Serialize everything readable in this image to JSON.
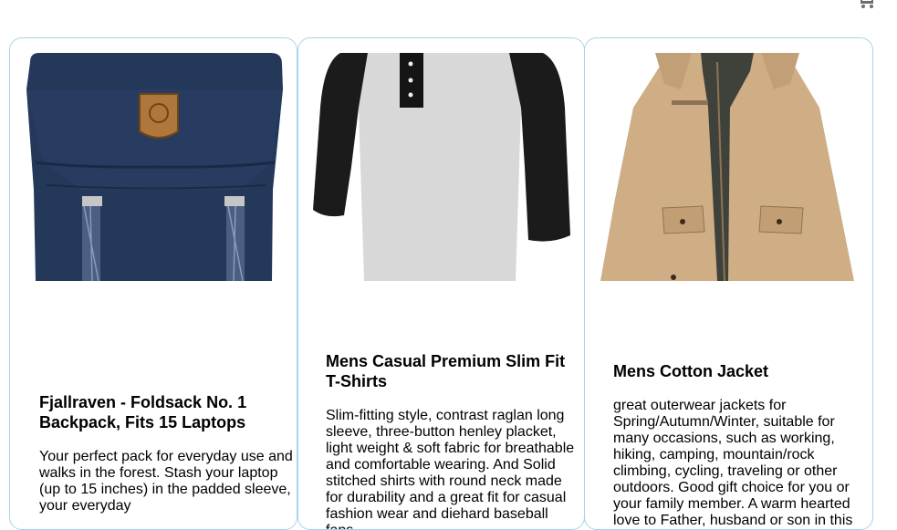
{
  "header": {
    "cart_icon": "shopping-cart-icon"
  },
  "products": [
    {
      "title": "Fjallraven - Foldsack No. 1 Backpack, Fits 15 Laptops",
      "description": "Your perfect pack for everyday use and walks in the forest. Stash your laptop (up to 15 inches) in the padded sleeve, your everyday",
      "image": "navy-backpack"
    },
    {
      "title": "Mens Casual Premium Slim Fit T-Shirts",
      "description": "Slim-fitting style, contrast raglan long sleeve, three-button henley placket, light weight & soft fabric for breathable and comfortable wearing. And Solid stitched shirts with round neck made for durability and a great fit for casual fashion wear and diehard baseball fans.",
      "image": "grey-black-raglan-shirt"
    },
    {
      "title": "Mens Cotton Jacket",
      "description": "great outerwear jackets for Spring/Autumn/Winter, suitable for many occasions, such as working, hiking, camping, mountain/rock climbing, cycling, traveling or other outdoors. Good gift choice for you or your family member. A warm hearted love to Father, husband or son in this thanksgiving or Christmas Day.",
      "image": "khaki-cotton-jacket"
    }
  ]
}
